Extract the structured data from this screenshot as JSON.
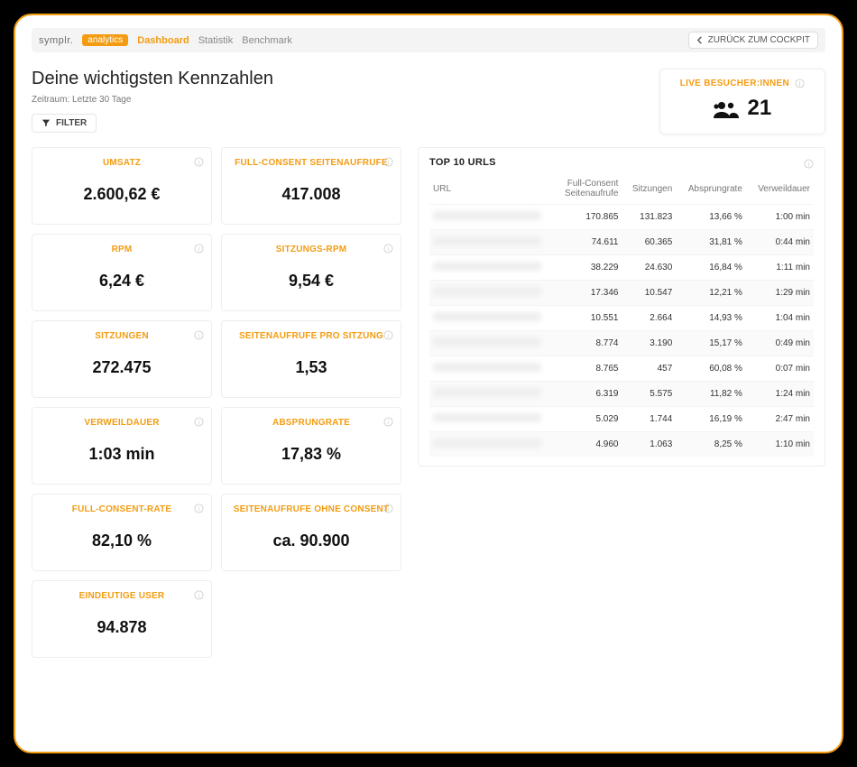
{
  "brand": {
    "name": "symplr.",
    "badge": "analytics"
  },
  "nav": {
    "dashboard": "Dashboard",
    "statistik": "Statistik",
    "benchmark": "Benchmark"
  },
  "back_button": "ZURÜCK ZUM COCKPIT",
  "headline": "Deine wichtigsten Kennzahlen",
  "timeframe": "Zeitraum: Letzte 30 Tage",
  "filter_label": "FILTER",
  "live": {
    "label": "LIVE BESUCHER:INNEN",
    "value": "21"
  },
  "cards": [
    {
      "title": "UMSATZ",
      "value": "2.600,62 €"
    },
    {
      "title": "FULL-CONSENT SEITENAUFRUFE",
      "value": "417.008"
    },
    {
      "title": "RPM",
      "value": "6,24 €"
    },
    {
      "title": "SITZUNGS-RPM",
      "value": "9,54 €"
    },
    {
      "title": "SITZUNGEN",
      "value": "272.475"
    },
    {
      "title": "SEITENAUFRUFE PRO SITZUNG",
      "value": "1,53"
    },
    {
      "title": "VERWEILDAUER",
      "value": "1:03 min"
    },
    {
      "title": "ABSPRUNGRATE",
      "value": "17,83 %"
    },
    {
      "title": "FULL-CONSENT-RATE",
      "value": "82,10 %"
    },
    {
      "title": "SEITENAUFRUFE OHNE CONSENT",
      "value": "ca. 90.900"
    },
    {
      "title": "EINDEUTIGE USER",
      "value": "94.878"
    }
  ],
  "table": {
    "title": "TOP 10 URLS",
    "columns": {
      "url": "URL",
      "fc": "Full-Consent Seitenaufrufe",
      "sessions": "Sitzungen",
      "bounce": "Absprungrate",
      "duration": "Verweildauer"
    },
    "rows": [
      {
        "fc": "170.865",
        "sessions": "131.823",
        "bounce": "13,66 %",
        "duration": "1:00 min"
      },
      {
        "fc": "74.611",
        "sessions": "60.365",
        "bounce": "31,81 %",
        "duration": "0:44 min"
      },
      {
        "fc": "38.229",
        "sessions": "24.630",
        "bounce": "16,84 %",
        "duration": "1:11 min"
      },
      {
        "fc": "17.346",
        "sessions": "10.547",
        "bounce": "12,21 %",
        "duration": "1:29 min"
      },
      {
        "fc": "10.551",
        "sessions": "2.664",
        "bounce": "14,93 %",
        "duration": "1:04 min"
      },
      {
        "fc": "8.774",
        "sessions": "3.190",
        "bounce": "15,17 %",
        "duration": "0:49 min"
      },
      {
        "fc": "8.765",
        "sessions": "457",
        "bounce": "60,08 %",
        "duration": "0:07 min"
      },
      {
        "fc": "6.319",
        "sessions": "5.575",
        "bounce": "11,82 %",
        "duration": "1:24 min"
      },
      {
        "fc": "5.029",
        "sessions": "1.744",
        "bounce": "16,19 %",
        "duration": "2:47 min"
      },
      {
        "fc": "4.960",
        "sessions": "1.063",
        "bounce": "8,25 %",
        "duration": "1:10 min"
      }
    ]
  }
}
